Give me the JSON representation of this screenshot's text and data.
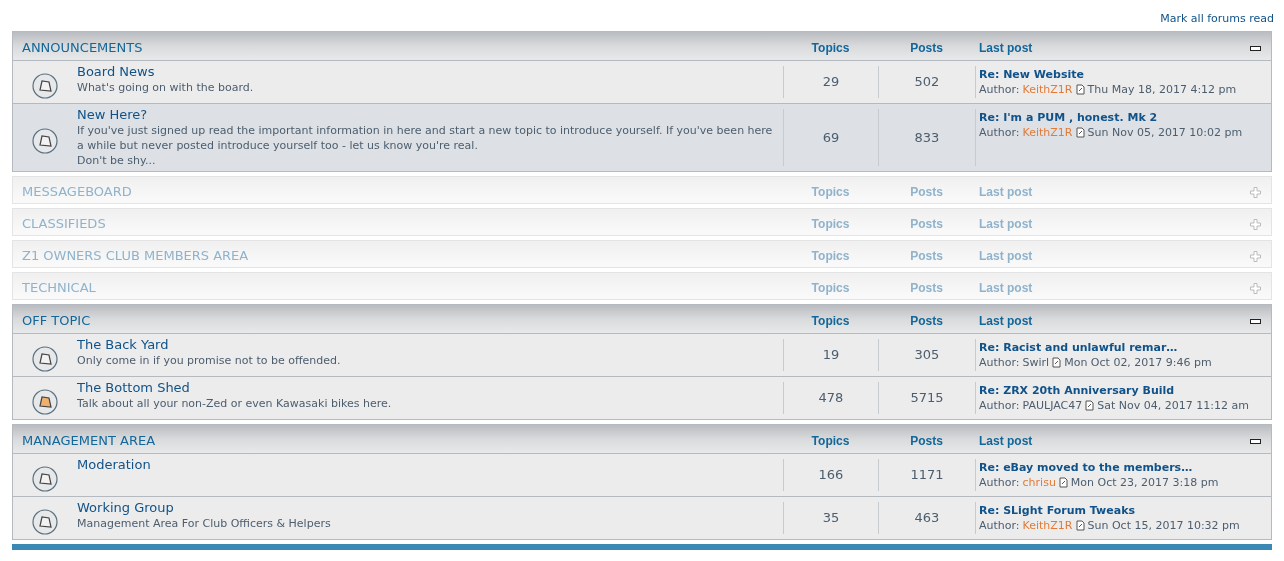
{
  "mark_all_link": "Mark all forums read",
  "categories": [
    {
      "title": "ANNOUNCEMENTS",
      "expanded": true,
      "col_topics": "Topics",
      "col_posts": "Posts",
      "col_last": "Last post",
      "forums": [
        {
          "name": "Board News",
          "description": "What's going on with the board.",
          "unread": false,
          "highlighted": false,
          "topics": "29",
          "posts": "502",
          "last_title": "Re: New Website",
          "author_label": "Author:",
          "author": "KeithZ1R",
          "author_highlighted": true,
          "time": "Thu May 18, 2017 4:12 pm"
        },
        {
          "name": "New Here?",
          "description": "If you've just signed up read the important information in here and start a new topic to introduce yourself. If you've been here a while but never posted introduce yourself too - let us know you're real.",
          "description_2": "Don't be shy...",
          "unread": false,
          "highlighted": true,
          "topics": "69",
          "posts": "833",
          "last_title": "Re: I'm a PUM , honest. Mk 2",
          "author_label": "Author:",
          "author": "KeithZ1R",
          "author_highlighted": true,
          "time": "Sun Nov 05, 2017 10:02 pm"
        }
      ]
    },
    {
      "title": "MESSAGEBOARD",
      "expanded": false,
      "col_topics": "Topics",
      "col_posts": "Posts",
      "col_last": "Last post"
    },
    {
      "title": "CLASSIFIEDS",
      "expanded": false,
      "col_topics": "Topics",
      "col_posts": "Posts",
      "col_last": "Last post"
    },
    {
      "title": "Z1 OWNERS CLUB MEMBERS AREA",
      "expanded": false,
      "col_topics": "Topics",
      "col_posts": "Posts",
      "col_last": "Last post"
    },
    {
      "title": "TECHNICAL",
      "expanded": false,
      "col_topics": "Topics",
      "col_posts": "Posts",
      "col_last": "Last post"
    },
    {
      "title": "OFF TOPIC",
      "expanded": true,
      "col_topics": "Topics",
      "col_posts": "Posts",
      "col_last": "Last post",
      "forums": [
        {
          "name": "The Back Yard",
          "description": "Only come in if you promise not to be offended.",
          "unread": false,
          "highlighted": false,
          "topics": "19",
          "posts": "305",
          "last_title": "Re: Racist and unlawful remar…",
          "author_label": "Author:",
          "author": "Swirl",
          "author_highlighted": false,
          "time": "Mon Oct 02, 2017 9:46 pm"
        },
        {
          "name": "The Bottom Shed",
          "description": "Talk about all your non-Zed or even Kawasaki bikes here.",
          "unread": true,
          "highlighted": false,
          "topics": "478",
          "posts": "5715",
          "last_title": "Re: ZRX 20th Anniversary Build",
          "author_label": "Author:",
          "author": "PAULJAC47",
          "author_highlighted": false,
          "time": "Sat Nov 04, 2017 11:12 am"
        }
      ]
    },
    {
      "title": "MANAGEMENT AREA",
      "expanded": true,
      "col_topics": "Topics",
      "col_posts": "Posts",
      "col_last": "Last post",
      "forums": [
        {
          "name": "Moderation",
          "unread": false,
          "highlighted": false,
          "topics": "166",
          "posts": "1171",
          "last_title": "Re: eBay moved to the members…",
          "author_label": "Author:",
          "author": "chrisu",
          "author_highlighted": true,
          "time": "Mon Oct 23, 2017 3:18 pm"
        },
        {
          "name": "Working Group",
          "description": "Management Area For Club Officers & Helpers",
          "unread": false,
          "highlighted": false,
          "topics": "35",
          "posts": "463",
          "last_title": "Re: SLight Forum Tweaks",
          "author_label": "Author:",
          "author": "KeithZ1R",
          "author_highlighted": true,
          "time": "Sun Oct 15, 2017 10:32 pm"
        }
      ]
    }
  ]
}
